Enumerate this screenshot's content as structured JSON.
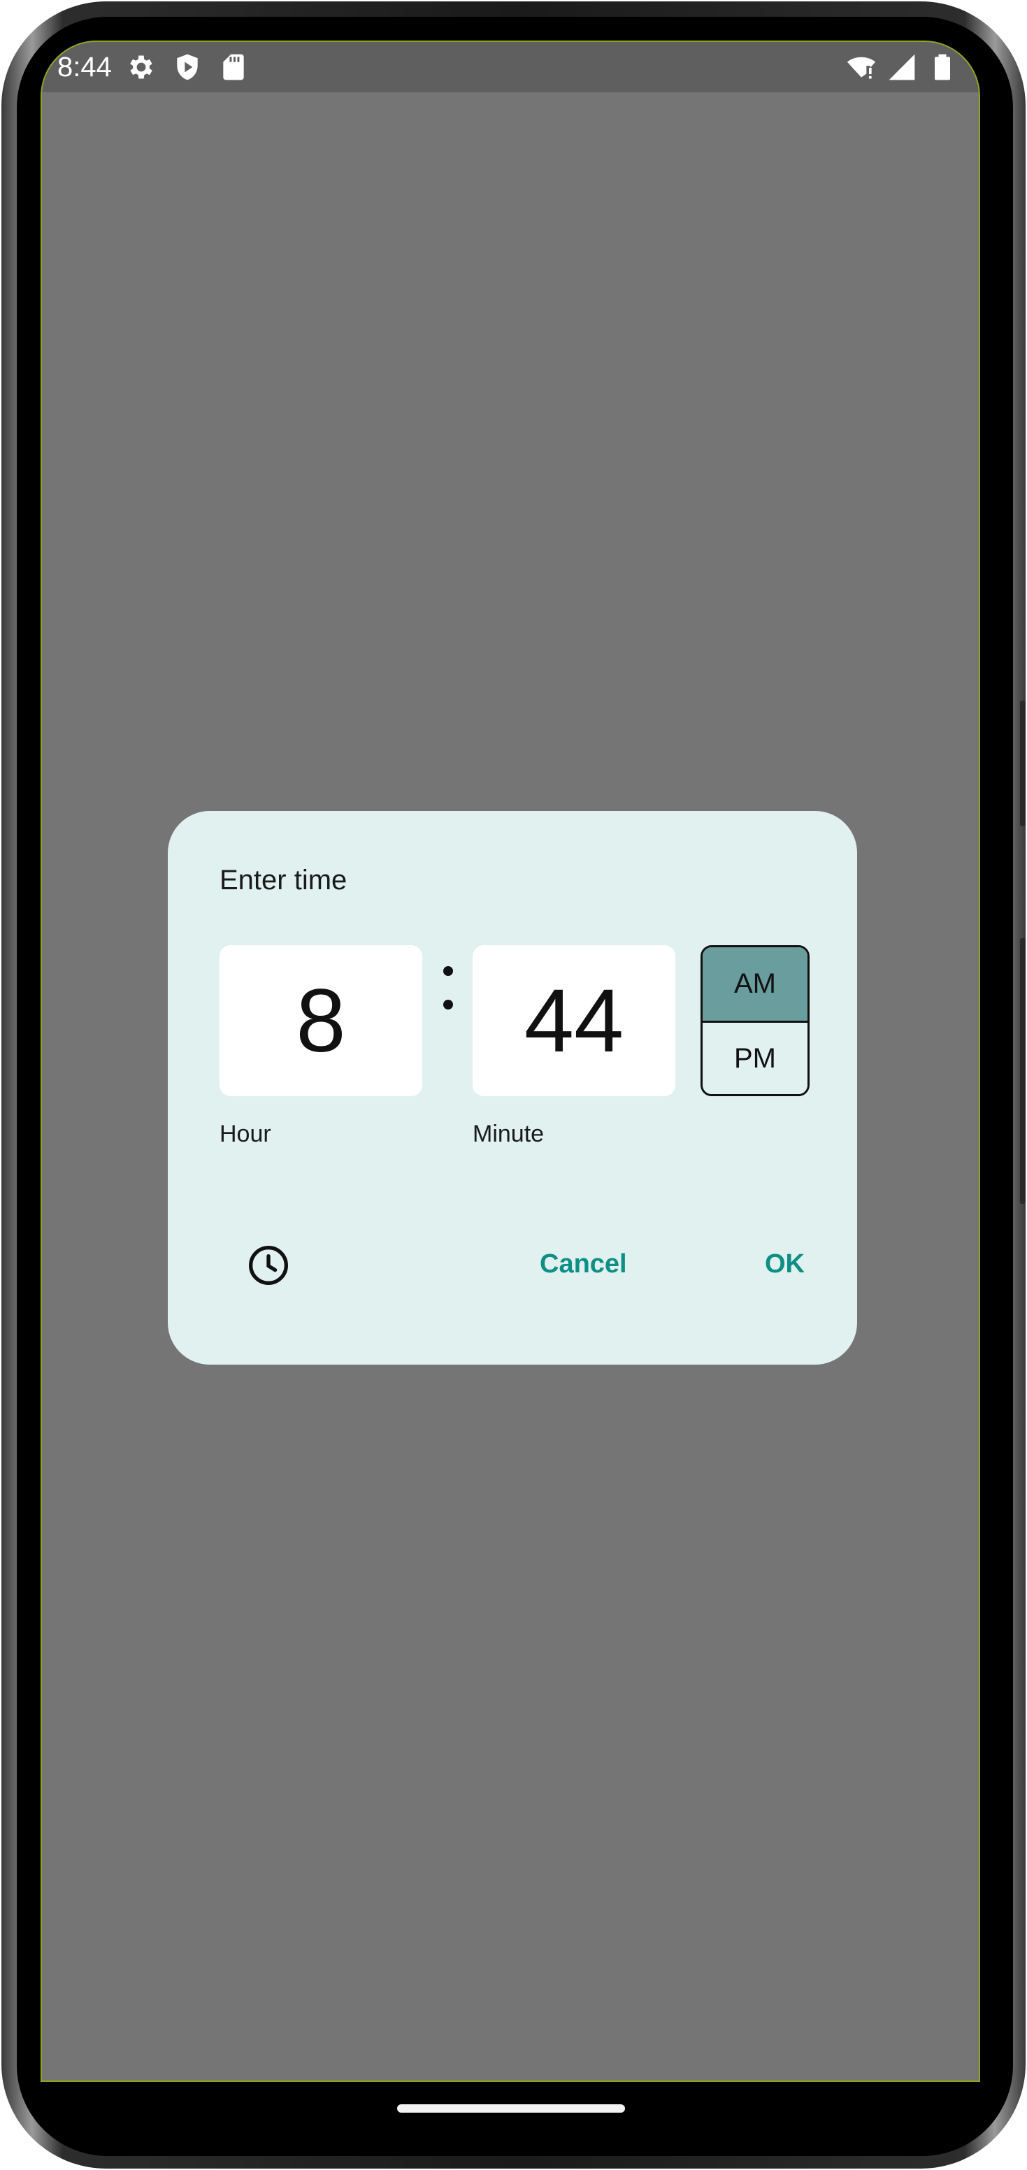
{
  "status_bar": {
    "time": "8:44",
    "left_icons": [
      "gear-icon",
      "shield-play-icon",
      "sd-card-icon"
    ],
    "right_icons": [
      "wifi-alert-icon",
      "signal-icon",
      "battery-icon"
    ]
  },
  "dialog": {
    "title": "Enter time",
    "hour": {
      "value": "8",
      "label": "Hour"
    },
    "minute": {
      "value": "44",
      "label": "Minute"
    },
    "period": {
      "options": [
        "AM",
        "PM"
      ],
      "selected": "AM"
    },
    "mode_toggle_icon": "clock-icon",
    "actions": {
      "cancel": "Cancel",
      "ok": "OK"
    }
  },
  "colors": {
    "scrim": "#757575",
    "dialog_background": "#e0f1ef",
    "selected_period": "#6a9d9e",
    "accent": "#0e8f85"
  }
}
